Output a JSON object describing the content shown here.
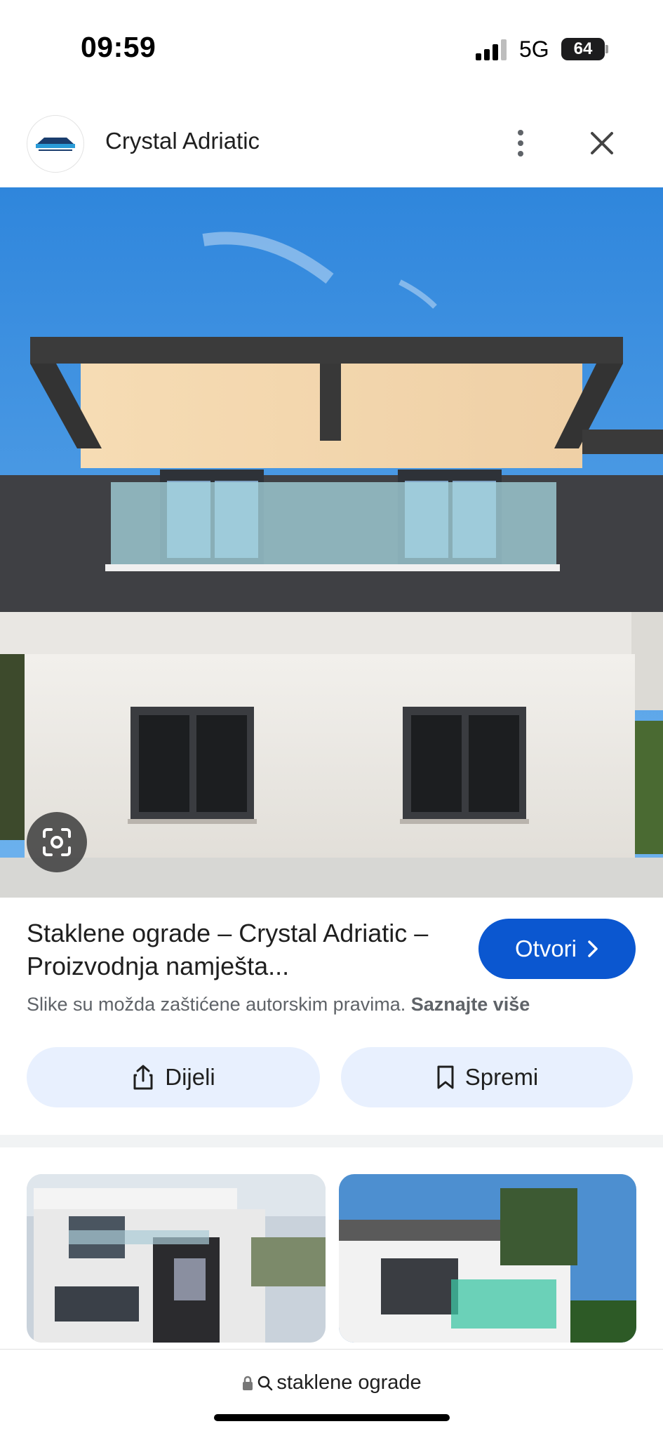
{
  "status_bar": {
    "time": "09:59",
    "network": "5G",
    "battery": "64"
  },
  "header": {
    "logo_text": "CRYSTAL",
    "logo_subtext": "ADRIATIC",
    "site_name": "Crystal Adriatic",
    "more_icon": "more-vert-icon",
    "close_icon": "close-icon"
  },
  "main_image": {
    "lens_icon": "lens-search-icon"
  },
  "result": {
    "title": "Staklene ograde – Crystal Adriatic – Proizvodnja namješta...",
    "open_label": "Otvori",
    "copyright_text": "Slike su možda zaštićene autorskim pravima.",
    "learn_more": "Saznajte više"
  },
  "actions": {
    "share_label": "Dijeli",
    "save_label": "Spremi"
  },
  "related": {
    "count_visible": 2
  },
  "bottom_bar": {
    "query": "staklene ograde"
  },
  "colors": {
    "accent": "#0b57d0",
    "pill_bg": "#e8f0fe",
    "sky": "#3c8fe0"
  }
}
